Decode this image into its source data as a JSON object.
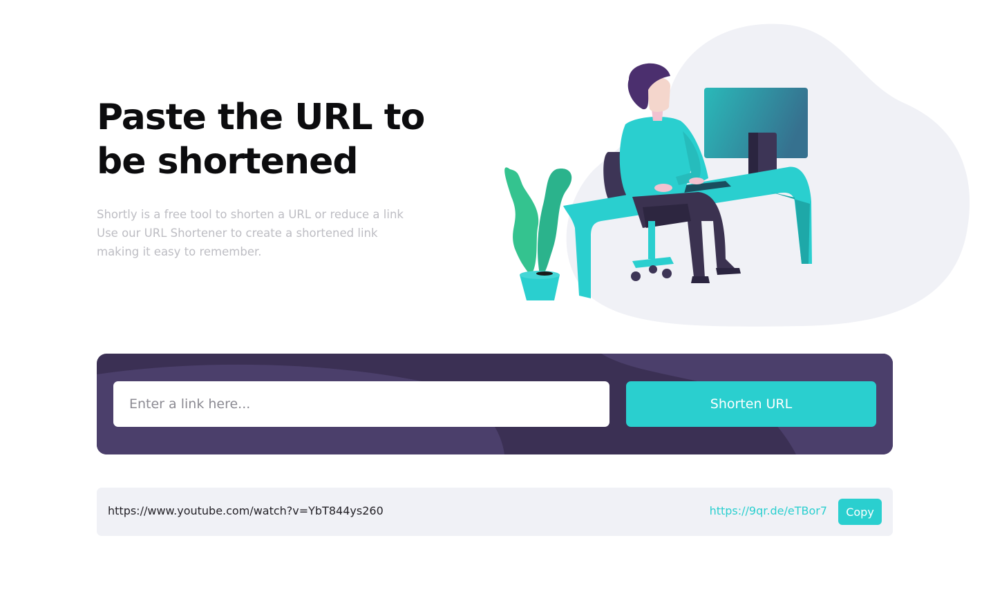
{
  "hero": {
    "title": "Paste the URL to be shortened",
    "description_lines": [
      "Shortly is a free tool to shorten a URL or reduce a link",
      "Use our URL Shortener to create a shortened link",
      "making it easy to remember."
    ]
  },
  "form": {
    "input_value": "",
    "input_placeholder": "Enter a link here...",
    "button_label": "Shorten URL"
  },
  "result": {
    "original_url": "https://www.youtube.com/watch?v=YbT844ys260",
    "short_url": "https://9qr.de/eTBor7",
    "copy_label": "Copy"
  },
  "colors": {
    "accent": "#2acfcf",
    "panel": "#3b3054",
    "panel_shape": "#4b3f6b",
    "result_bg": "#f0f1f6",
    "blob": "#f0f1f6"
  },
  "icons": {
    "illustration": "person-working-at-desk-illustration"
  }
}
